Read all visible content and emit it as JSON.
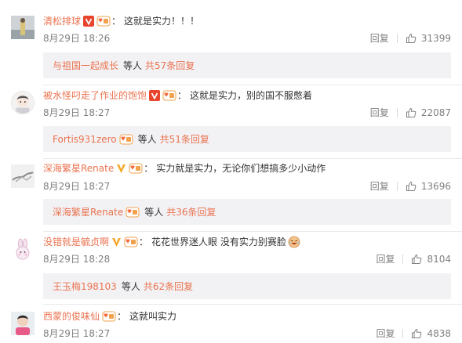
{
  "comments": [
    {
      "username": "清松排球",
      "badges": [
        "verified-v",
        "fan-badge"
      ],
      "colon": "：",
      "text": "这就是实力！！！",
      "time": "8月29日 18:26",
      "reply_label": "回复",
      "likes": "31399",
      "subreply": {
        "username": "与祖国一起成长",
        "badge": "",
        "dengren": "等人",
        "more": "共57条回复"
      }
    },
    {
      "username": "被水怪叼走了作业的饱饱",
      "badges": [
        "verified-v",
        "fan-badge"
      ],
      "colon": "：",
      "text": "这就是实力，别的国不服憋着",
      "time": "8月29日 18:27",
      "reply_label": "回复",
      "likes": "22087",
      "subreply": {
        "username": "Fortis931zero",
        "badge": "fan-badge",
        "dengren": "等人",
        "more": "共51条回复"
      }
    },
    {
      "username": "深海繁星Renate",
      "badges": [
        "verified-v-gold",
        "fan-badge"
      ],
      "colon": "：",
      "text": "实力就是实力，无论你们想搞多少小动作",
      "time": "8月29日 18:27",
      "reply_label": "回复",
      "likes": "13696",
      "subreply": {
        "username": "深海繁星Renate",
        "badge": "fan-badge",
        "dengren": "等人",
        "more": "共36条回复"
      }
    },
    {
      "username": "没错就是毓贞啊",
      "badges": [
        "verified-v-gold",
        "fan-badge"
      ],
      "colon": "：",
      "text": "花花世界迷人眼 没有实力别赛脸",
      "time": "8月29日 18:28",
      "reply_label": "回复",
      "likes": "8104",
      "subreply": {
        "username": "王玉梅198103",
        "badge": "",
        "dengren": "等人",
        "more": "共62条回复"
      }
    },
    {
      "username": "西蒙的俊味仙",
      "badges": [
        "fan-badge"
      ],
      "colon": "：",
      "text": "这就叫实力",
      "time": "8月29日 18:27",
      "reply_label": "回复",
      "likes": "4838"
    }
  ],
  "colors": {
    "username": "#eb7350",
    "text": "#333333",
    "meta": "#808080",
    "subreply_bg": "#f2f2f5",
    "verified_red": "#e8452c",
    "verified_gold": "#f6a623"
  },
  "icons": {
    "like": "thumbs-up-icon",
    "emoji": "laughing-emoji-icon"
  }
}
